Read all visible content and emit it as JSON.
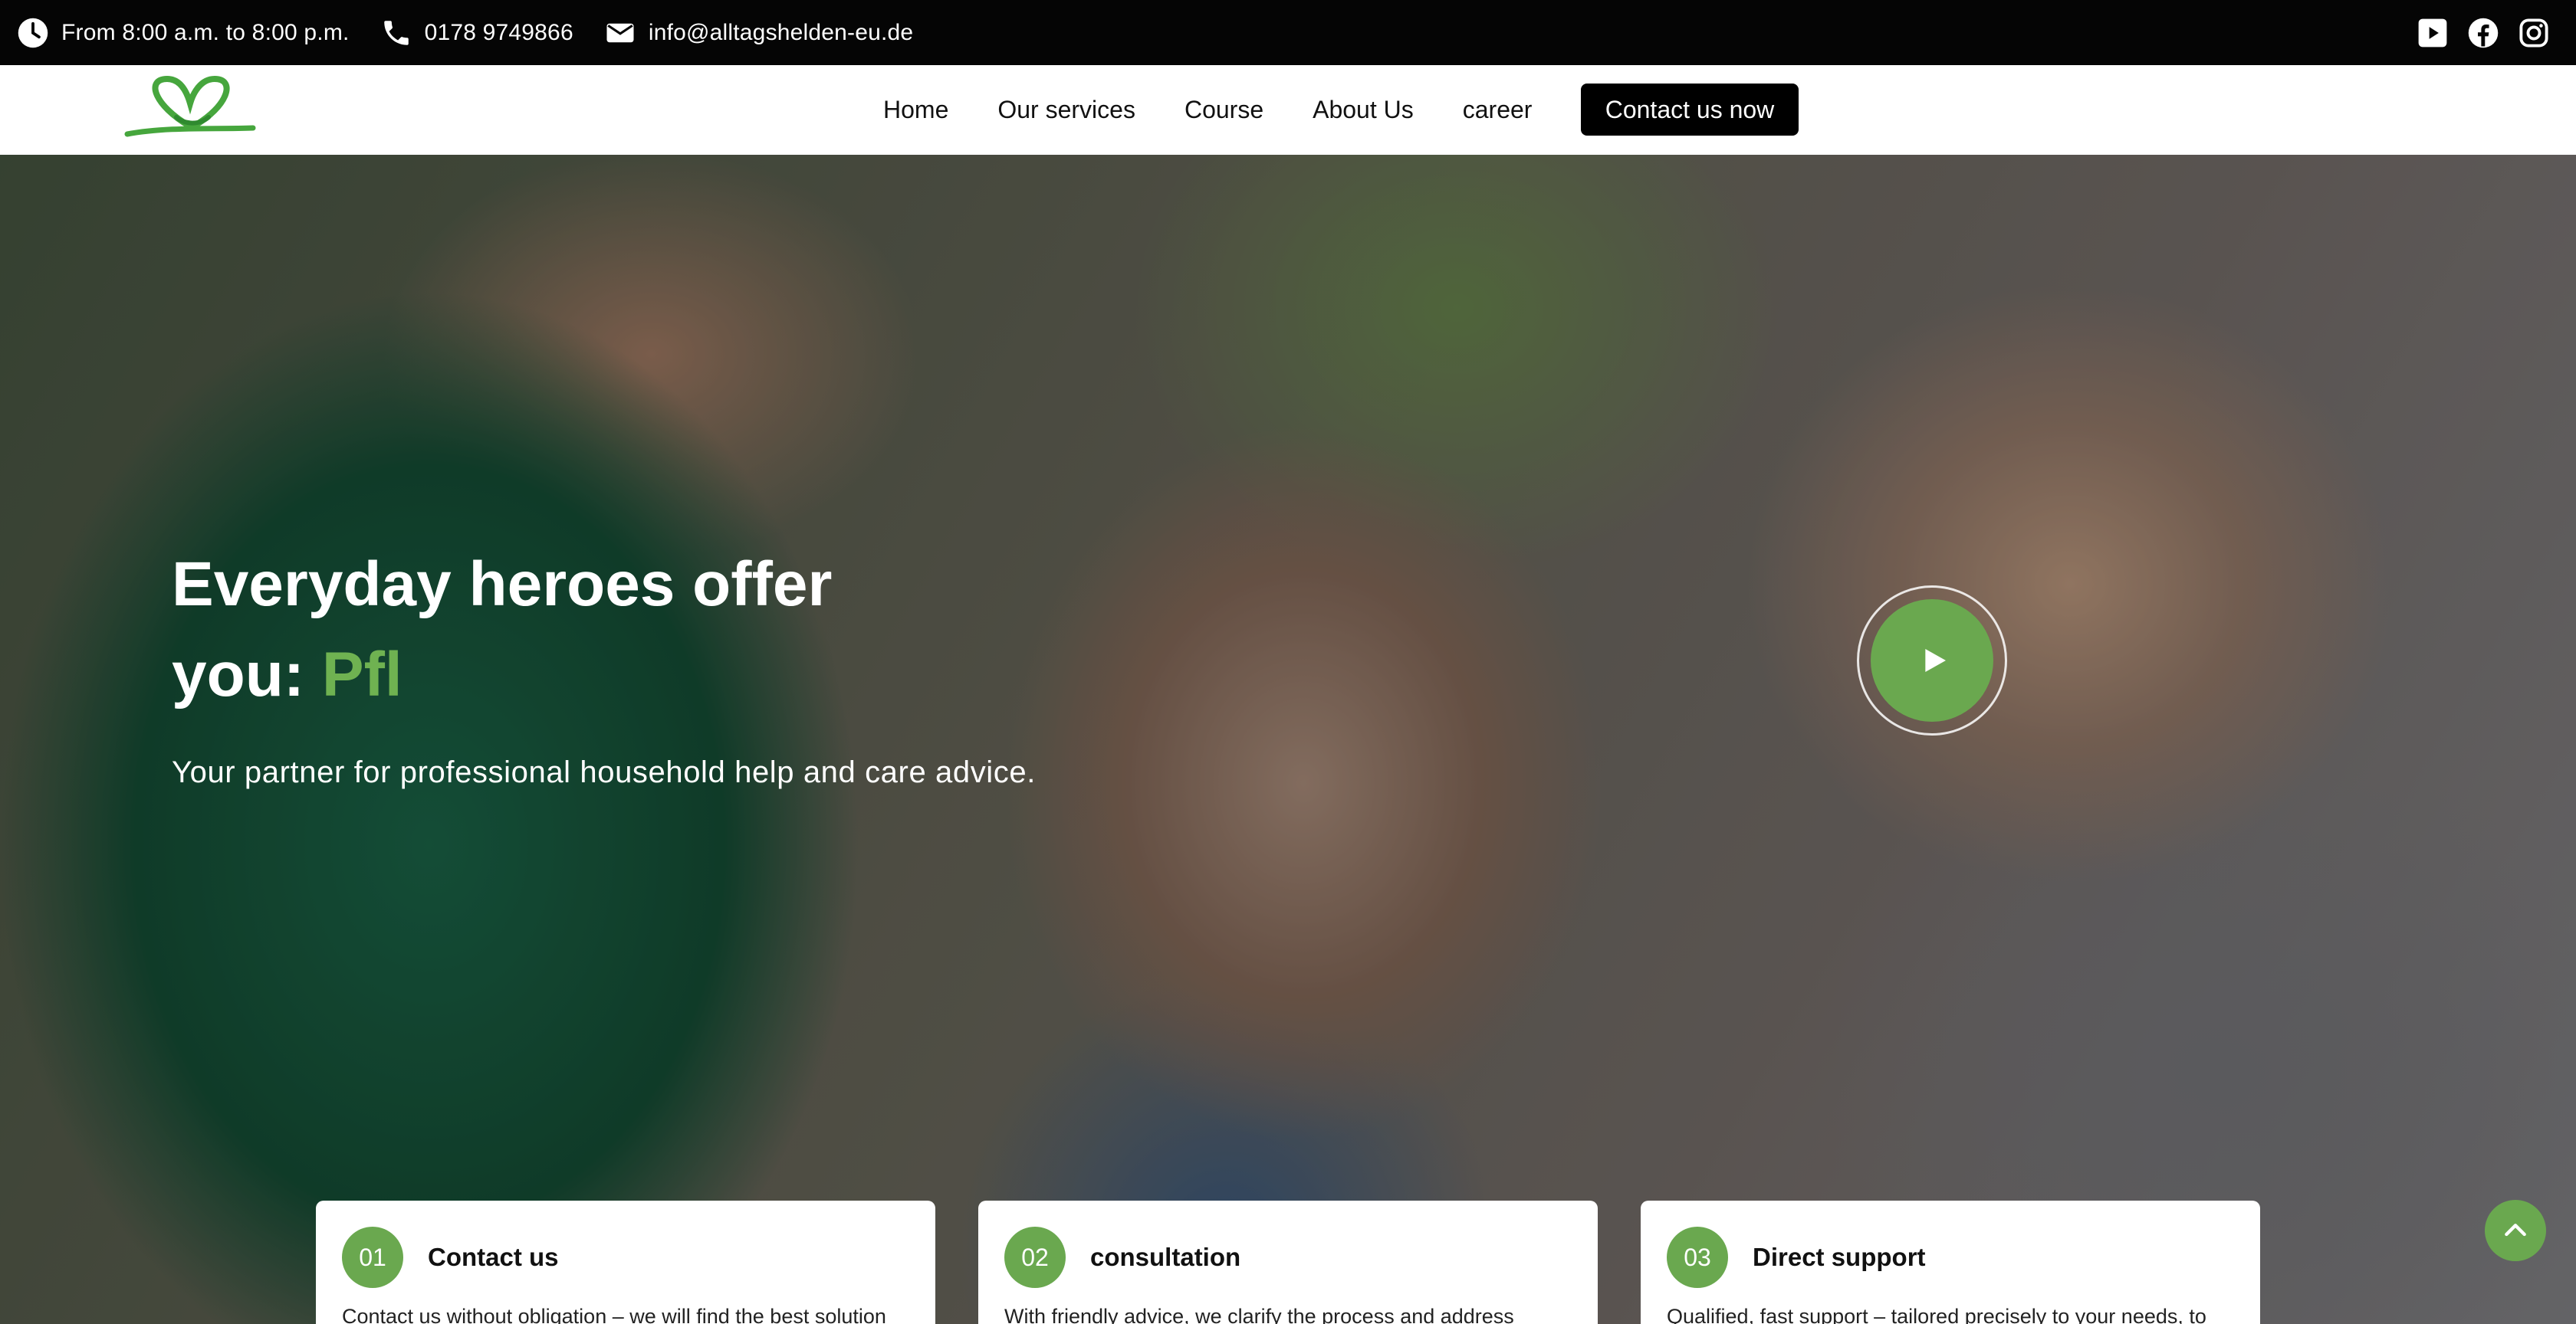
{
  "topbar": {
    "hours": "From 8:00 a.m. to 8:00 p.m.",
    "phone": "0178 9749866",
    "email": "info@alltagshelden-eu.de",
    "icons": [
      "clock-icon",
      "phone-icon",
      "mail-icon"
    ],
    "social": [
      "youtube-icon",
      "facebook-icon",
      "instagram-icon"
    ]
  },
  "nav": {
    "items": [
      "Home",
      "Our services",
      "Course",
      "About Us",
      "career"
    ],
    "cta": "Contact us now"
  },
  "hero": {
    "title": "Everyday heroes offer you: ",
    "title_accent": "Pfl",
    "subtitle": "Your partner for professional household help and care advice."
  },
  "cards": [
    {
      "number": "01",
      "title": "Contact us",
      "text": "Contact us without obligation – we will find the best solution"
    },
    {
      "number": "02",
      "title": "consultation",
      "text": "With friendly advice, we clarify the process and address"
    },
    {
      "number": "03",
      "title": "Direct support",
      "text": "Qualified, fast support – tailored precisely to your needs, to"
    }
  ],
  "colors": {
    "accent_green": "#6aa84f",
    "topbar_bg": "#050505",
    "cta_bg": "#000000"
  }
}
